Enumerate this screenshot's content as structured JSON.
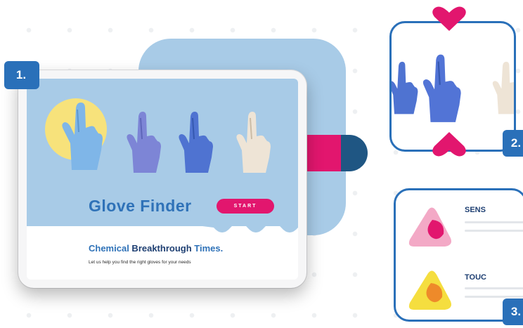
{
  "badges": {
    "one": "1.",
    "two": "2.",
    "three": "3."
  },
  "tablet": {
    "hero_title": "Glove Finder",
    "start_button": "START",
    "headline_part1": "Chemical",
    "headline_part2": " Breakthrough",
    "headline_part3": " Times.",
    "subtext": "Let us help you find the right gloves for your needs"
  },
  "card3": {
    "item1_title": "SENS",
    "item2_title": "TOUC"
  },
  "colors": {
    "accent_blue": "#2a70b9",
    "hero_blue": "#a8cbe7",
    "pink": "#e2166e",
    "navy": "#1f5683",
    "yellow": "#f7e27b"
  },
  "icons": [
    "glove-icon",
    "heart-pin-icon",
    "triangle-icon"
  ]
}
